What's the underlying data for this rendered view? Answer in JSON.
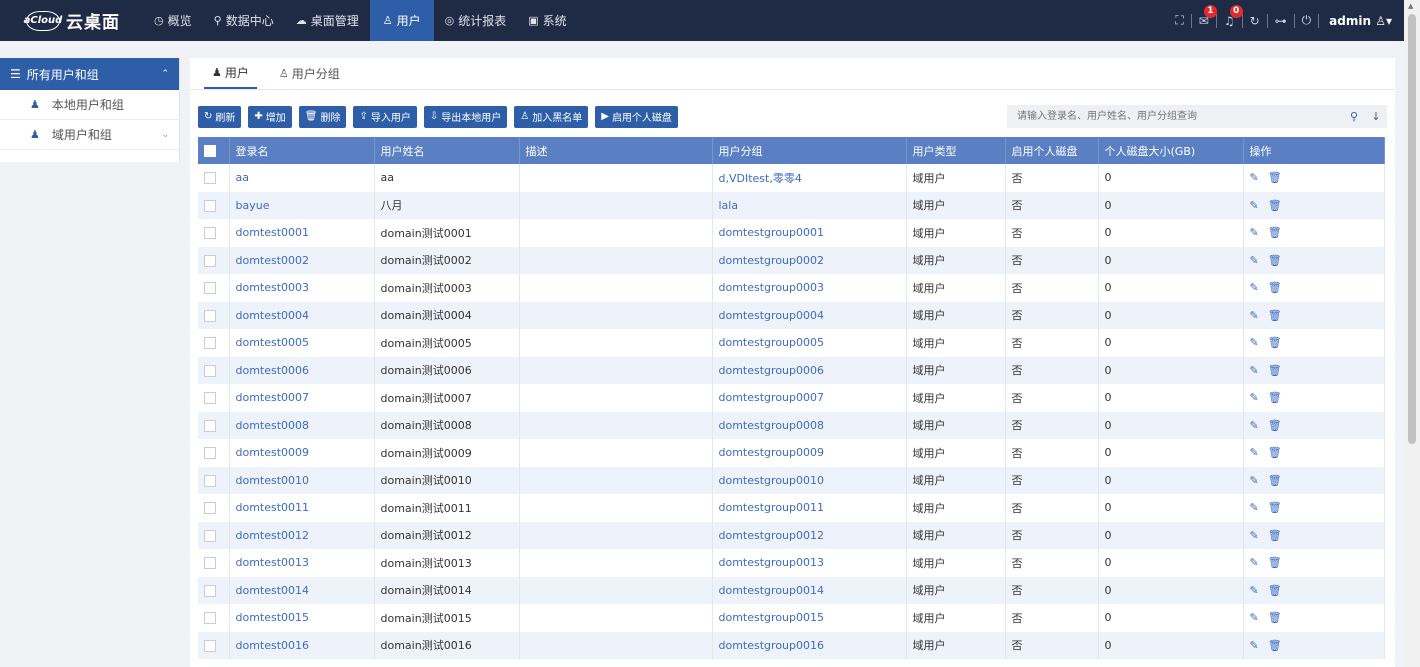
{
  "app": {
    "logo_badge": "aCloud",
    "title": "云桌面"
  },
  "nav": [
    {
      "icon": "◷",
      "label": "概览"
    },
    {
      "icon": "⚲",
      "label": "数据中心"
    },
    {
      "icon": "☁",
      "label": "桌面管理"
    },
    {
      "icon": "♙",
      "label": "用户"
    },
    {
      "icon": "◎",
      "label": "统计报表"
    },
    {
      "icon": "▣",
      "label": "系统"
    }
  ],
  "topbar": {
    "mail_count": "1",
    "bell_count": "0",
    "user": "admin"
  },
  "sidebar": {
    "header": "所有用户和组",
    "items": [
      {
        "label": "本地用户和组"
      },
      {
        "label": "域用户和组"
      }
    ]
  },
  "tabs": [
    {
      "label": "用户"
    },
    {
      "label": "用户分组"
    }
  ],
  "toolbar": {
    "refresh": "刷新",
    "add": "增加",
    "delete": "删除",
    "import": "导入用户",
    "export": "导出本地用户",
    "blacklist": "加入黑名单",
    "enable_disk": "启用个人磁盘",
    "search_placeholder": "请输入登录名、用户姓名、用户分组查询"
  },
  "table": {
    "headers": [
      "登录名",
      "用户姓名",
      "描述",
      "用户分组",
      "用户类型",
      "启用个人磁盘",
      "个人磁盘大小(GB)",
      "操作"
    ],
    "rows": [
      {
        "login": "aa",
        "name": "aa",
        "desc": "",
        "group": "d,VDItest,零零4",
        "type": "域用户",
        "disk": "否",
        "size": "0"
      },
      {
        "login": "bayue",
        "name": "八月",
        "desc": "",
        "group": "lala",
        "type": "域用户",
        "disk": "否",
        "size": "0"
      },
      {
        "login": "domtest0001",
        "name": "domain测试0001",
        "desc": "",
        "group": "domtestgroup0001",
        "type": "域用户",
        "disk": "否",
        "size": "0"
      },
      {
        "login": "domtest0002",
        "name": "domain测试0002",
        "desc": "",
        "group": "domtestgroup0002",
        "type": "域用户",
        "disk": "否",
        "size": "0"
      },
      {
        "login": "domtest0003",
        "name": "domain测试0003",
        "desc": "",
        "group": "domtestgroup0003",
        "type": "域用户",
        "disk": "否",
        "size": "0"
      },
      {
        "login": "domtest0004",
        "name": "domain测试0004",
        "desc": "",
        "group": "domtestgroup0004",
        "type": "域用户",
        "disk": "否",
        "size": "0"
      },
      {
        "login": "domtest0005",
        "name": "domain测试0005",
        "desc": "",
        "group": "domtestgroup0005",
        "type": "域用户",
        "disk": "否",
        "size": "0"
      },
      {
        "login": "domtest0006",
        "name": "domain测试0006",
        "desc": "",
        "group": "domtestgroup0006",
        "type": "域用户",
        "disk": "否",
        "size": "0"
      },
      {
        "login": "domtest0007",
        "name": "domain测试0007",
        "desc": "",
        "group": "domtestgroup0007",
        "type": "域用户",
        "disk": "否",
        "size": "0"
      },
      {
        "login": "domtest0008",
        "name": "domain测试0008",
        "desc": "",
        "group": "domtestgroup0008",
        "type": "域用户",
        "disk": "否",
        "size": "0"
      },
      {
        "login": "domtest0009",
        "name": "domain测试0009",
        "desc": "",
        "group": "domtestgroup0009",
        "type": "域用户",
        "disk": "否",
        "size": "0"
      },
      {
        "login": "domtest0010",
        "name": "domain测试0010",
        "desc": "",
        "group": "domtestgroup0010",
        "type": "域用户",
        "disk": "否",
        "size": "0"
      },
      {
        "login": "domtest0011",
        "name": "domain测试0011",
        "desc": "",
        "group": "domtestgroup0011",
        "type": "域用户",
        "disk": "否",
        "size": "0"
      },
      {
        "login": "domtest0012",
        "name": "domain测试0012",
        "desc": "",
        "group": "domtestgroup0012",
        "type": "域用户",
        "disk": "否",
        "size": "0"
      },
      {
        "login": "domtest0013",
        "name": "domain测试0013",
        "desc": "",
        "group": "domtestgroup0013",
        "type": "域用户",
        "disk": "否",
        "size": "0"
      },
      {
        "login": "domtest0014",
        "name": "domain测试0014",
        "desc": "",
        "group": "domtestgroup0014",
        "type": "域用户",
        "disk": "否",
        "size": "0"
      },
      {
        "login": "domtest0015",
        "name": "domain测试0015",
        "desc": "",
        "group": "domtestgroup0015",
        "type": "域用户",
        "disk": "否",
        "size": "0"
      },
      {
        "login": "domtest0016",
        "name": "domain测试0016",
        "desc": "",
        "group": "domtestgroup0016",
        "type": "域用户",
        "disk": "否",
        "size": "0"
      }
    ]
  },
  "colors": {
    "topbar": "#1f2a44",
    "accent": "#2e5ea8",
    "table_header": "#5a80c3",
    "link": "#3c6cc0"
  }
}
